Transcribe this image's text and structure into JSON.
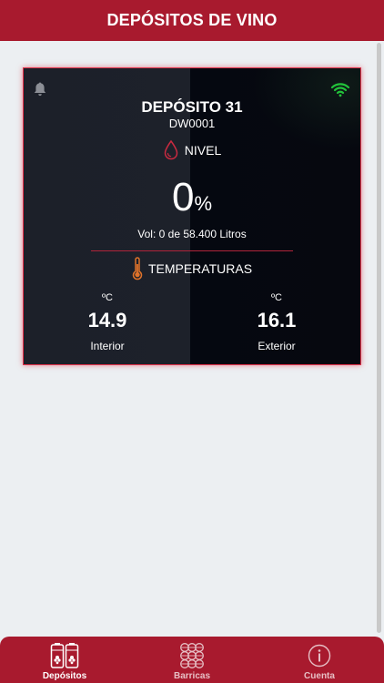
{
  "header": {
    "title": "DEPÓSITOS DE VINO"
  },
  "tank": {
    "name": "DEPÓSITO 31",
    "code": "DW0001",
    "level_label": "NIVEL",
    "level_value": "0",
    "level_unit": "%",
    "volume_text": "Vol: 0 de 58.400 Litros",
    "temp_label": "TEMPERATURAS",
    "interior": {
      "unit": "ºC",
      "value": "14.9",
      "label": "Interior"
    },
    "exterior": {
      "unit": "ºC",
      "value": "16.1",
      "label": "Exterior"
    },
    "status_icons": [
      "bell-icon",
      "wifi-icon"
    ],
    "wifi_color": "#22c33a"
  },
  "tabs": [
    {
      "label": "Depósitos",
      "icon": "tanks-icon",
      "active": true
    },
    {
      "label": "Barricas",
      "icon": "barrels-icon",
      "active": false
    },
    {
      "label": "Cuenta",
      "icon": "info-icon",
      "active": false
    }
  ],
  "colors": {
    "brand": "#a81a2e",
    "card_border": "#e0324a"
  }
}
